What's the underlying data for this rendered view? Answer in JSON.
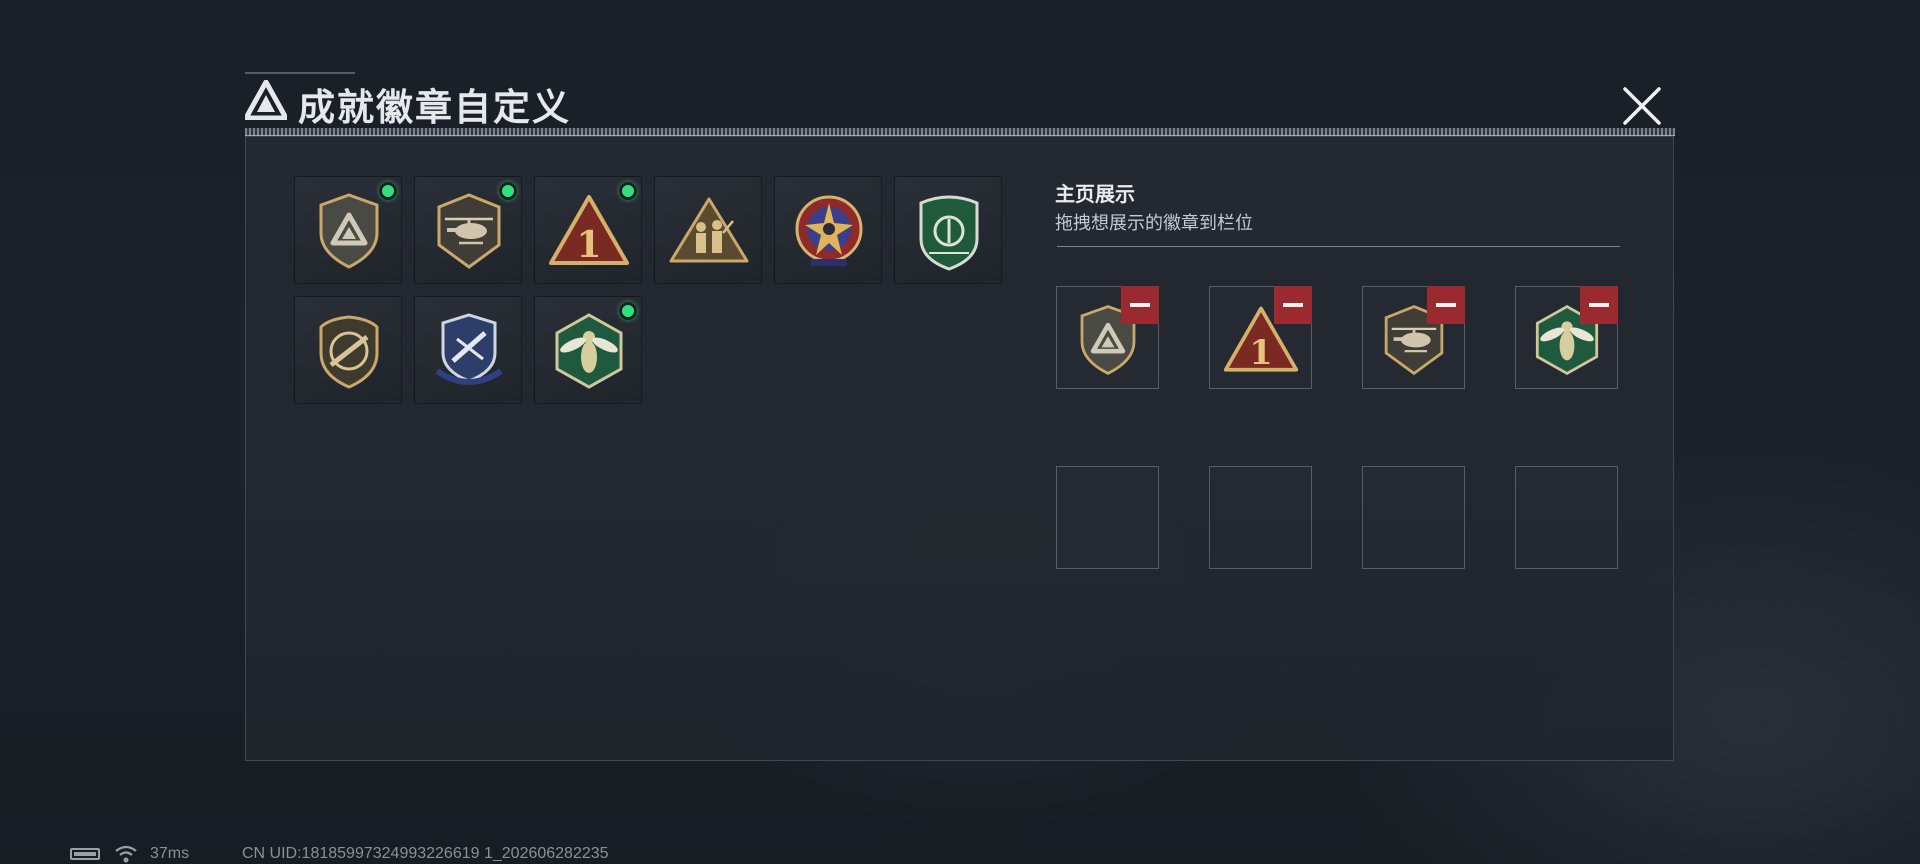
{
  "window": {
    "title": "成就徽章自定义",
    "logo_icon": "delta-triangle-logo-icon",
    "close_icon": "close-x-icon"
  },
  "badge_collection": [
    {
      "icon": "shield-delta-badge-icon",
      "is_new": true
    },
    {
      "icon": "helicopter-shield-badge-icon",
      "is_new": true
    },
    {
      "icon": "red-triangle-number-one-badge-icon",
      "is_new": true
    },
    {
      "icon": "soldiers-triangle-badge-icon",
      "is_new": false
    },
    {
      "icon": "star-medal-badge-icon",
      "is_new": false
    },
    {
      "icon": "green-shield-emblem-badge-icon",
      "is_new": false
    },
    {
      "icon": "rifle-shield-badge-icon",
      "is_new": false
    },
    {
      "icon": "blue-winged-shield-badge-icon",
      "is_new": false
    },
    {
      "icon": "hornet-hexagon-badge-icon",
      "is_new": true
    }
  ],
  "showcase": {
    "title": "主页展示",
    "subtitle": "拖拽想展示的徽章到栏位",
    "slots": [
      {
        "icon": "shield-delta-badge-icon",
        "filled": true
      },
      {
        "icon": "red-triangle-number-one-badge-icon",
        "filled": true
      },
      {
        "icon": "helicopter-shield-badge-icon",
        "filled": true
      },
      {
        "icon": "hornet-hexagon-badge-icon",
        "filled": true
      },
      {
        "filled": false
      },
      {
        "filled": false
      },
      {
        "filled": false
      },
      {
        "filled": false
      }
    ],
    "remove_icon": "minus-icon"
  },
  "status_bar": {
    "battery_icon": "battery-icon",
    "wifi_icon": "wifi-icon",
    "ping": "37ms",
    "uid": "CN UID:18185997324993226619 1_202606282235"
  },
  "colors": {
    "new_indicator": "#2fe07e",
    "remove_button": "#9a2a30",
    "badge_gold": "#c9a86a"
  }
}
